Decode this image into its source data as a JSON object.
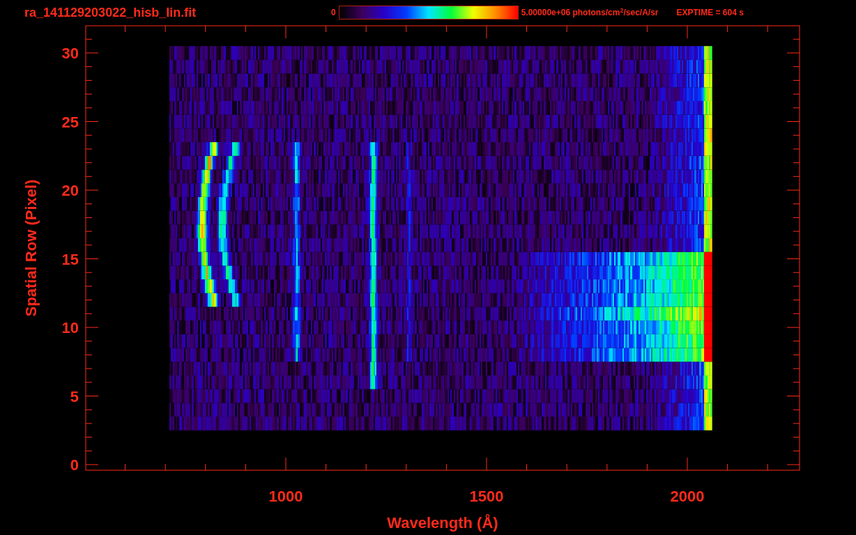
{
  "header": {
    "filename": "ra_141129203022_hisb_lin.fit",
    "colorbar": {
      "min_label": "0",
      "max_label": "5.00000e+06 photons/cm$^{2}$/sec/A/sr"
    },
    "exposure": "EXPTIME = 604 s"
  },
  "plot": {
    "y_axis": {
      "title": "Spatial Row (Pixel)",
      "ticks": [
        "30",
        "25",
        "20",
        "15",
        "10",
        "5",
        "0"
      ]
    },
    "x_axis": {
      "title": "Wavelength (Å)",
      "ticks": [
        "1000",
        "1500",
        "2000"
      ]
    }
  }
}
